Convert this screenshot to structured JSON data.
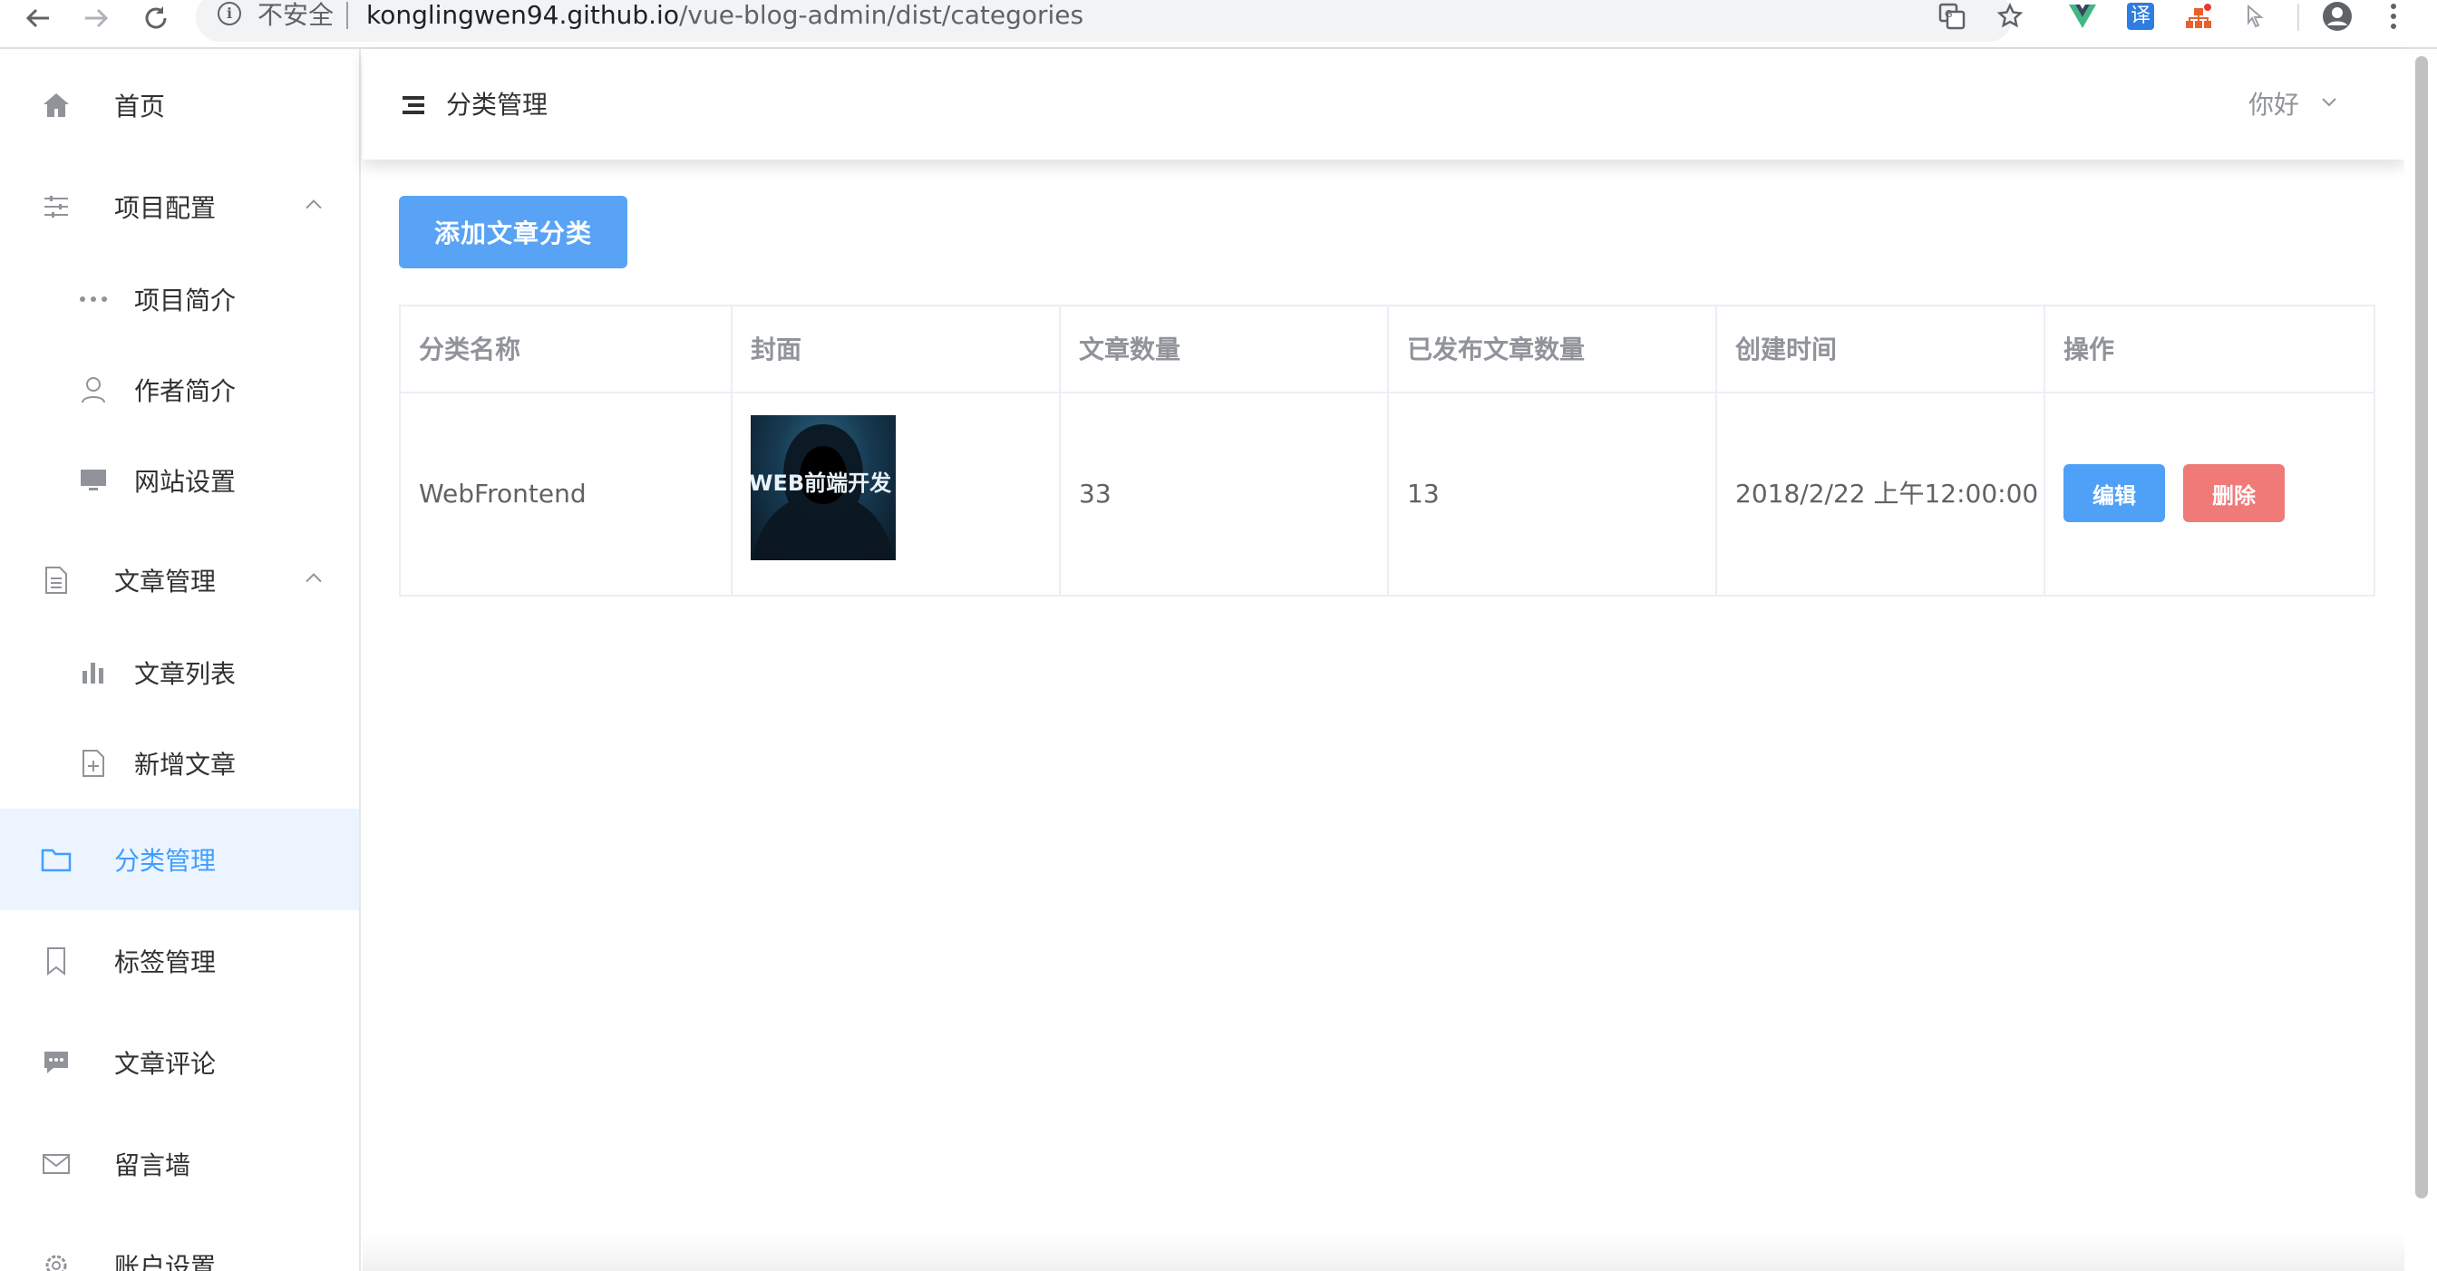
{
  "browser": {
    "insecure_label": "不安全",
    "url_host": "konglingwen94.github.io",
    "url_path": "/vue-blog-admin/dist/categories",
    "ext_translate_label": "译"
  },
  "sidebar": {
    "home": "首页",
    "project_config": "项目配置",
    "project_intro": "项目简介",
    "author_intro": "作者简介",
    "site_settings": "网站设置",
    "article_mgmt": "文章管理",
    "article_list": "文章列表",
    "new_article": "新增文章",
    "category_mgmt": "分类管理",
    "tag_mgmt": "标签管理",
    "article_comments": "文章评论",
    "message_wall": "留言墙",
    "account_settings": "账户设置"
  },
  "header": {
    "title": "分类管理",
    "user": "你好"
  },
  "main": {
    "add_button": "添加文章分类",
    "columns": [
      "分类名称",
      "封面",
      "文章数量",
      "已发布文章数量",
      "创建时间",
      "操作"
    ],
    "rows": [
      {
        "name": "WebFrontend",
        "cover_text": "WEB前端开发",
        "article_count": "33",
        "published_count": "13",
        "created_at": "2018/2/22 上午12:00:00",
        "edit_label": "编辑",
        "delete_label": "删除"
      }
    ]
  },
  "colors": {
    "primary": "#409eff",
    "danger": "#f56c6c",
    "active_bg": "#ecf5ff"
  }
}
